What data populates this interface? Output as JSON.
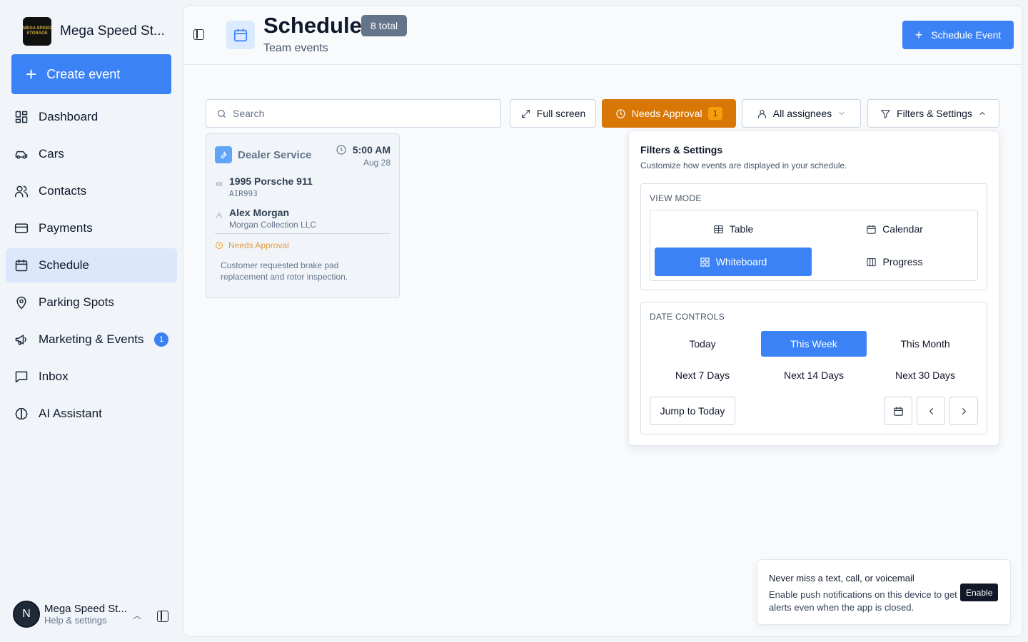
{
  "sidebar": {
    "brand_name": "Mega Speed St...",
    "logo_text_top": "MEGA SPEED",
    "logo_text_bottom": "STORAGE",
    "create_label": "Create event",
    "items": [
      {
        "label": "Dashboard",
        "icon": "dashboard-icon"
      },
      {
        "label": "Cars",
        "icon": "car-icon"
      },
      {
        "label": "Contacts",
        "icon": "contacts-icon"
      },
      {
        "label": "Payments",
        "icon": "credit-card-icon"
      },
      {
        "label": "Schedule",
        "icon": "calendar-icon",
        "active": true
      },
      {
        "label": "Parking Spots",
        "icon": "map-pin-icon"
      },
      {
        "label": "Marketing & Events",
        "icon": "megaphone-icon",
        "badge": "1"
      },
      {
        "label": "Inbox",
        "icon": "message-square-icon"
      },
      {
        "label": "AI Assistant",
        "icon": "brain-icon"
      }
    ],
    "user": {
      "initial": "N",
      "name": "Mega Speed St...",
      "sub": "Help & settings"
    }
  },
  "header": {
    "title": "Schedule",
    "badge": "8 total",
    "subtitle": "Team events",
    "schedule_button": "Schedule Event"
  },
  "toolbar": {
    "search_placeholder": "Search",
    "fullscreen_label": "Full screen",
    "approval_label": "Needs Approval",
    "approval_count": "1",
    "assignees_label": "All assignees",
    "filters_label": "Filters & Settings"
  },
  "event_card": {
    "type": "Dealer Service",
    "time": "5:00 AM",
    "date": "Aug 28",
    "car": "1995 Porsche 911",
    "plate": "AIR993",
    "person": "Alex Morgan",
    "company": "Morgan Collection LLC",
    "status": "Needs Approval",
    "note": "Customer requested brake pad replacement and rotor inspection."
  },
  "filters": {
    "title": "Filters & Settings",
    "subtitle": "Customize how events are displayed in your schedule.",
    "view_mode_label": "VIEW MODE",
    "view_modes": [
      {
        "label": "Table",
        "icon": "table-icon"
      },
      {
        "label": "Calendar",
        "icon": "calendar-icon"
      },
      {
        "label": "Whiteboard",
        "icon": "grid-icon",
        "active": true
      },
      {
        "label": "Progress",
        "icon": "columns-icon"
      }
    ],
    "date_controls_label": "DATE CONTROLS",
    "date_options": [
      {
        "label": "Today"
      },
      {
        "label": "This Week",
        "active": true
      },
      {
        "label": "This Month"
      },
      {
        "label": "Next 7 Days"
      },
      {
        "label": "Next 14 Days"
      },
      {
        "label": "Next 30 Days"
      }
    ],
    "jump_label": "Jump to Today"
  },
  "toast": {
    "title": "Never miss a text, call, or voicemail",
    "body": "Enable push notifications on this device to get alerts even when the app is closed.",
    "button": "Enable"
  },
  "colors": {
    "accent": "#3b82f6",
    "approval": "#d97706",
    "active_nav": "#dbe7fb"
  }
}
